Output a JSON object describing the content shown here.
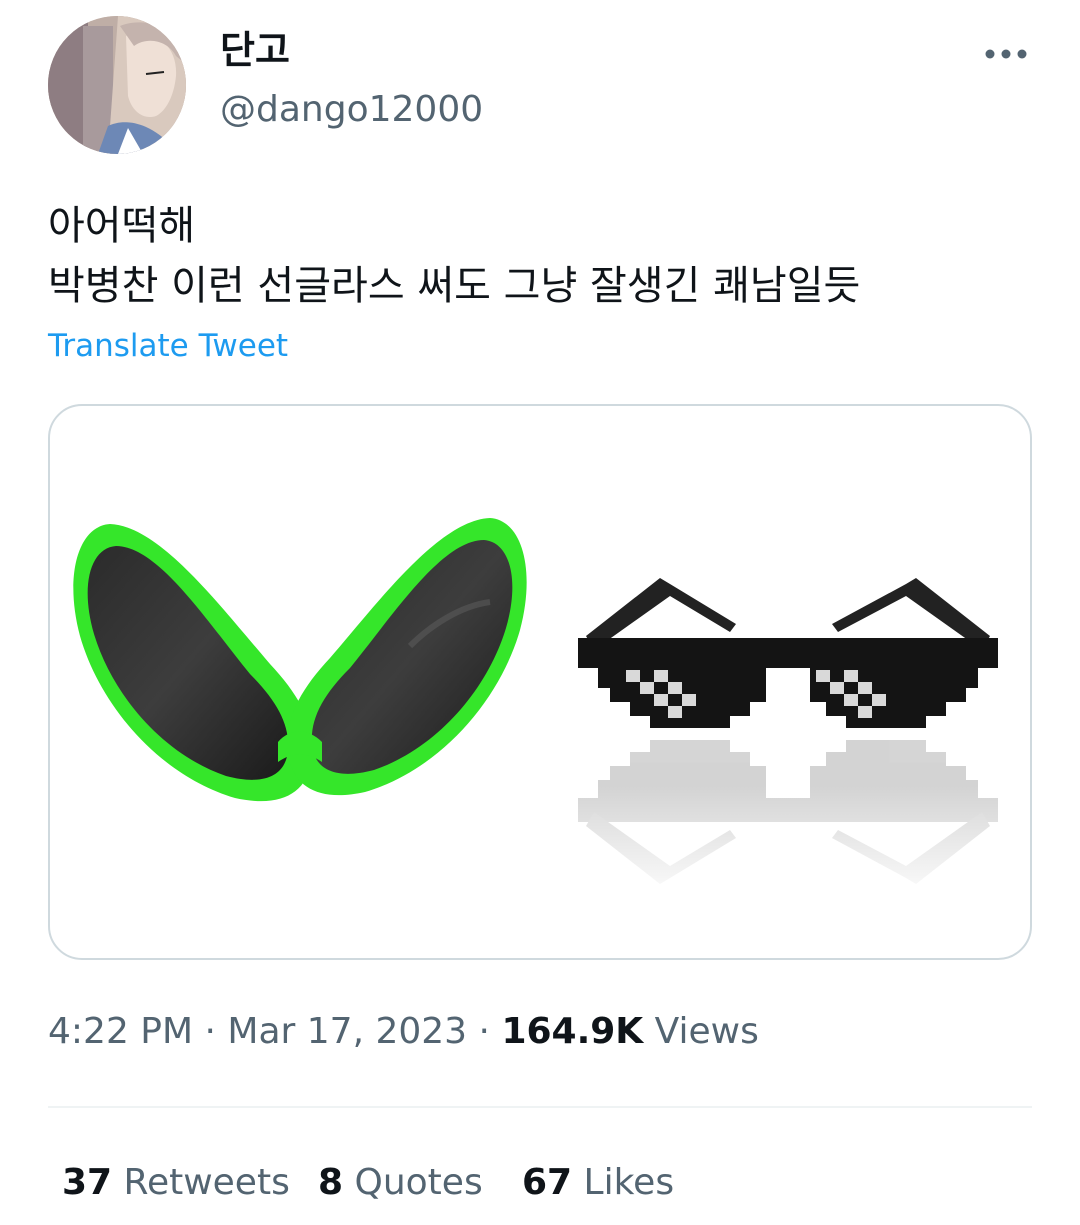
{
  "author": {
    "display_name": "단고",
    "handle": "@dango12000"
  },
  "tweet": {
    "lines": [
      "아어떡해",
      "박병찬 이런 선글라스 써도 그냥 잘생긴 쾌남일듯"
    ],
    "translate_label": "Translate Tweet"
  },
  "meta": {
    "time": "4:22 PM",
    "sep1": " · ",
    "date": "Mar 17, 2023",
    "sep2": " · ",
    "views_count": "164.9K",
    "views_label": " Views"
  },
  "stats": {
    "retweets_count": "37",
    "retweets_label": " Retweets",
    "quotes_count": "8",
    "quotes_label": " Quotes",
    "likes_count": "67",
    "likes_label": " Likes"
  },
  "icons": {
    "more": "more-horizontal-icon"
  },
  "colors": {
    "accent": "#1d9bf0",
    "secondary_text": "#536471",
    "primary_text": "#0f1419",
    "border": "#cfd9de",
    "alien_frame": "#35e62a"
  }
}
